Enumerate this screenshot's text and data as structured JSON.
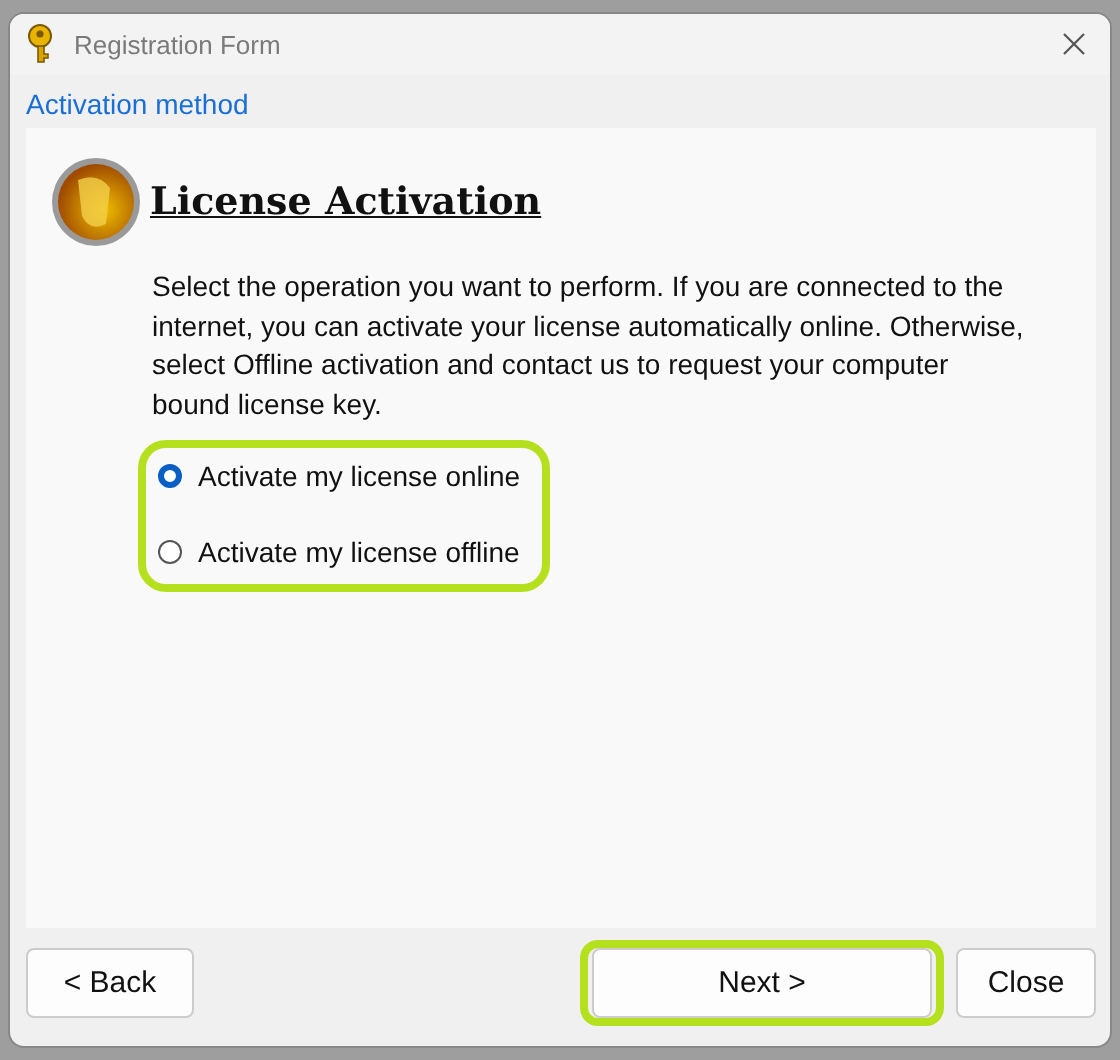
{
  "window": {
    "title": "Registration Form"
  },
  "section": "Activation method",
  "heading": "License Activation",
  "description": "Select the operation you want to perform. If you are connected to the internet, you can activate your license automatically online. Otherwise, select Offline activation and contact us to request your computer bound license key.",
  "options": [
    {
      "label": "Activate my license online",
      "selected": true
    },
    {
      "label": "Activate my license offline",
      "selected": false
    }
  ],
  "buttons": {
    "back": "< Back",
    "next": "Next >",
    "close": "Close"
  }
}
